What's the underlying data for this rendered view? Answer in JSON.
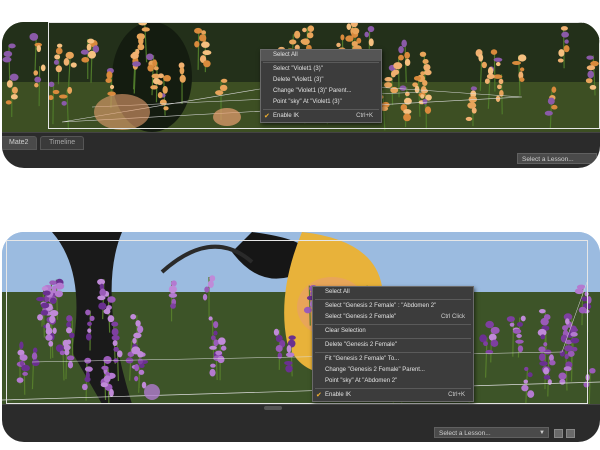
{
  "top_screenshot": {
    "tabs": [
      {
        "label": "Mate2",
        "active": true
      },
      {
        "label": "Timeline",
        "active": false
      }
    ],
    "lesson_select": {
      "label": "Select a Lesson..."
    },
    "context_menu": {
      "items": [
        {
          "label": "Select All",
          "highlighted": true
        },
        {
          "label": "Select \"Violet1 (3)\""
        },
        {
          "label": "Delete \"Violet1 (3)\""
        },
        {
          "label": "Change \"Violet1 (3)\" Parent..."
        },
        {
          "label": "Point \"sky\" At \"Violet1 (3)\""
        },
        {
          "label": "Enable IK",
          "checked": true,
          "shortcut": "Ctrl+K"
        }
      ]
    }
  },
  "bottom_screenshot": {
    "lesson_select": {
      "label": "Select a Lesson..."
    },
    "context_menu": {
      "items": [
        {
          "label": "Select All"
        },
        {
          "label": "Select \"Genesis 2 Female\" : \"Abdomen 2\""
        },
        {
          "label": "Select \"Genesis 2 Female\"",
          "shortcut": "Ctrl Click"
        },
        {
          "label": "Clear Selection"
        },
        {
          "label": "Delete \"Genesis 2 Female\""
        },
        {
          "label": "Fit \"Genesis 2 Female\" To..."
        },
        {
          "label": "Change \"Genesis 2 Female\" Parent..."
        },
        {
          "label": "Point \"sky\" At \"Abdomen 2\""
        },
        {
          "label": "Enable IK",
          "checked": true,
          "shortcut": "Ctrl+K"
        }
      ]
    }
  },
  "colors": {
    "menu_bg": "#3c3c3c",
    "menu_highlight": "#555555",
    "check_mark": "#f0b030",
    "toolbar_bg": "#2b2b2b"
  },
  "icons": {
    "check": "check-icon",
    "dropdown": "chevron-down-icon"
  }
}
